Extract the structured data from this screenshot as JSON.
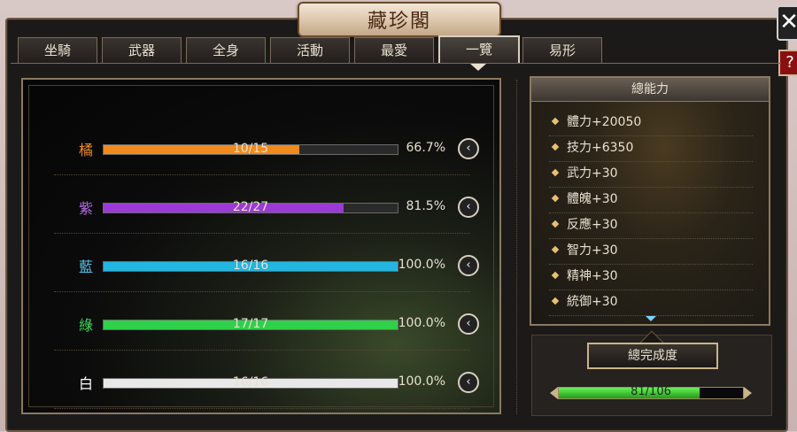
{
  "title": "藏珍閣",
  "close_glyph": "✕",
  "help_glyph": "?",
  "tabs": [
    {
      "label": "坐騎",
      "active": false
    },
    {
      "label": "武器",
      "active": false
    },
    {
      "label": "全身",
      "active": false
    },
    {
      "label": "活動",
      "active": false
    },
    {
      "label": "最愛",
      "active": false
    },
    {
      "label": "一覽",
      "active": true
    },
    {
      "label": "易形",
      "active": false
    }
  ],
  "collection": [
    {
      "label": "橘",
      "ratio": "10/15",
      "percent": "66.7%",
      "progress": 0.667,
      "color": "#f08a1c",
      "label_color": "#f08a1c"
    },
    {
      "label": "紫",
      "ratio": "22/27",
      "percent": "81.5%",
      "progress": 0.815,
      "color": "#9b3ad6",
      "label_color": "#b76ae8"
    },
    {
      "label": "藍",
      "ratio": "16/16",
      "percent": "100.0%",
      "progress": 1.0,
      "color": "#22b6e0",
      "label_color": "#52c6ee"
    },
    {
      "label": "綠",
      "ratio": "17/17",
      "percent": "100.0%",
      "progress": 1.0,
      "color": "#2fd04a",
      "label_color": "#3fd85a"
    },
    {
      "label": "白",
      "ratio": "16/16",
      "percent": "100.0%",
      "progress": 1.0,
      "color": "#e8e8e8",
      "label_color": "#ffffff"
    }
  ],
  "expand_glyph": "‹",
  "stats_panel": {
    "title": "總能力",
    "items": [
      "體力+20050",
      "技力+6350",
      "武力+30",
      "體魄+30",
      "反應+30",
      "智力+30",
      "精神+30",
      "統御+30"
    ]
  },
  "total": {
    "label": "總完成度",
    "ratio": "81/106",
    "progress": 0.764
  }
}
